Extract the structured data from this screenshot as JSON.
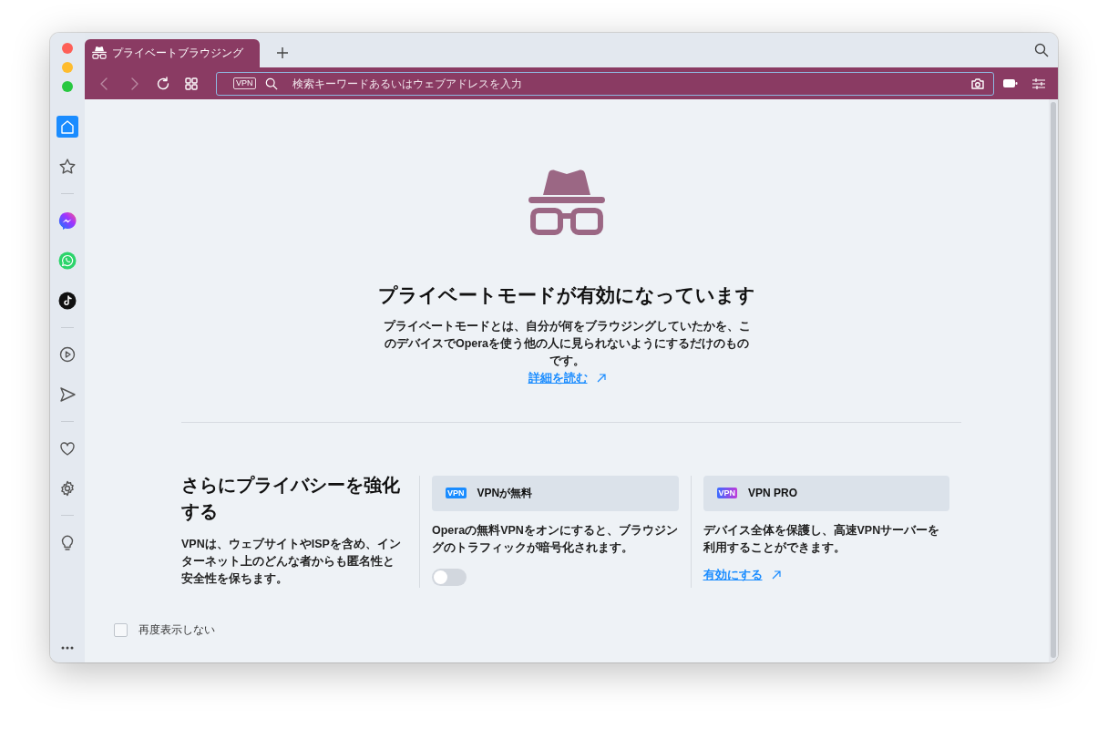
{
  "sidebar": {
    "items": [
      {
        "selected": true
      },
      {
        "selected": false
      },
      {
        "selected": false
      },
      {
        "selected": false
      },
      {
        "selected": false
      },
      {
        "selected": false
      },
      {
        "selected": false
      },
      {
        "selected": false
      },
      {
        "selected": false
      },
      {
        "selected": false
      }
    ]
  },
  "tabs": [
    {
      "title": "プライベートブラウジング",
      "selected": true
    }
  ],
  "address_bar": {
    "badge": "VPN",
    "placeholder": "検索キーワードあるいはウェブアドレスを入力"
  },
  "page": {
    "title": "プライベートモードが有効になっています",
    "description": "プライベートモードとは、自分が何をブラウジングしていたかを、このデバイスでOperaを使う他の人に見られないようにするだけのものです。",
    "link": "詳細を読む"
  },
  "section": {
    "heading": "さらにプライバシーを強化する",
    "text": "VPNは、ウェブサイトやISPを含め、インターネット上のどんな者からも匿名性と安全性を保ちます。",
    "cards": [
      {
        "kind": "toggle",
        "badge": "VPN",
        "title": "VPNが無料",
        "description": "Operaの無料VPNをオンにすると、ブラウジングのトラフィックが暗号化されます。",
        "on": false
      },
      {
        "kind": "link",
        "badge": "VPN",
        "title": "VPN PRO",
        "description": "デバイス全体を保護し、高速VPNサーバーを利用することができます。",
        "link": "有効にする"
      }
    ]
  },
  "dont_show_again": {
    "label": "再度表示しない",
    "checked": false
  }
}
